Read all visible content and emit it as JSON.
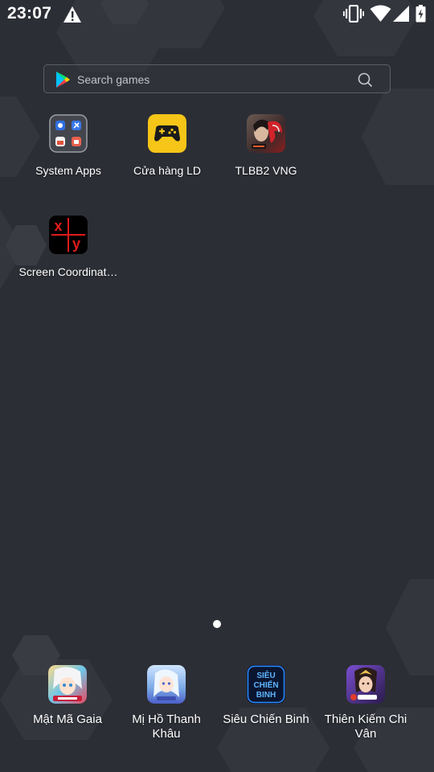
{
  "status_bar": {
    "time": "23:07",
    "icons": [
      "warning-icon",
      "vibrate-icon",
      "wifi-icon",
      "signal-icon",
      "battery-charging-icon"
    ]
  },
  "search": {
    "placeholder": "Search games",
    "left_icon": "google-play-icon",
    "right_icon": "search-icon"
  },
  "home_apps": [
    {
      "label": "System Apps",
      "icon": "folder-icon"
    },
    {
      "label": "Cửa hàng LD",
      "icon": "gamepad-icon"
    },
    {
      "label": "TLBB2 VNG",
      "icon": "tlbb2-game-icon"
    },
    {
      "label": "Screen Coordinat…",
      "icon": "xy-coordinates-icon"
    }
  ],
  "page_indicator": {
    "current": 1,
    "total": 1
  },
  "dock": [
    {
      "label": "Mật Mã Gaia",
      "icon": "mat-ma-gaia-icon"
    },
    {
      "label": "Mị Hồ Thanh Khâu",
      "icon": "mi-ho-thanh-khau-icon"
    },
    {
      "label": "Siêu Chiến Binh",
      "icon": "sieu-chien-binh-icon",
      "logo_text": "SIÊU CHIẾN BINH"
    },
    {
      "label": "Thiên Kiếm Chi Vân",
      "icon": "thien-kiem-chi-van-icon"
    }
  ],
  "colors": {
    "background": "#2c2e35",
    "gamepad_yellow": "#f5c518",
    "sieu_chien_binh_blue": "#2d8cff"
  }
}
